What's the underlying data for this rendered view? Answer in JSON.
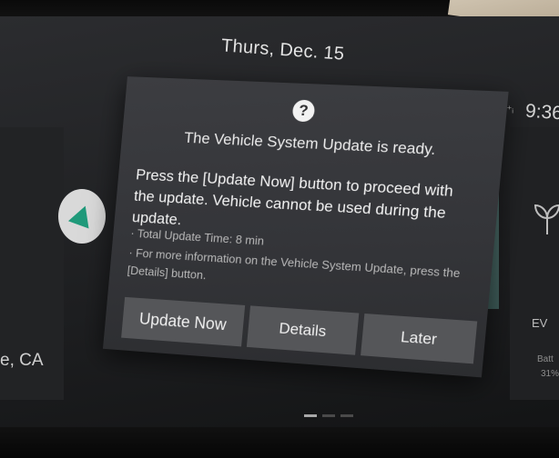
{
  "header": {
    "date": "Thurs, Dec. 15",
    "time": "9:36",
    "signal_icon": "signal-icon"
  },
  "background_widgets": {
    "location_text": "e, CA",
    "ev_label": "EV",
    "battery_label": "Batt",
    "battery_value": "31%"
  },
  "dialog": {
    "icon": "question-icon",
    "icon_glyph": "?",
    "title": "The Vehicle System Update is ready.",
    "message": "Press the [Update Now] button to proceed with the update. Vehicle cannot be used during the update.",
    "bullets": [
      "· Total Update Time: 8 min",
      "· For more information on the Vehicle System Update, press the [Details] button."
    ],
    "buttons": {
      "update_now": "Update Now",
      "details": "Details",
      "later": "Later"
    }
  },
  "pagination": {
    "count": 3,
    "active_index": 0
  },
  "colors": {
    "dialog_bg": "#37383c",
    "button_bg": "#555659",
    "nav_accent": "#1f9a7a",
    "teal_tile": "#4d6e6b"
  }
}
